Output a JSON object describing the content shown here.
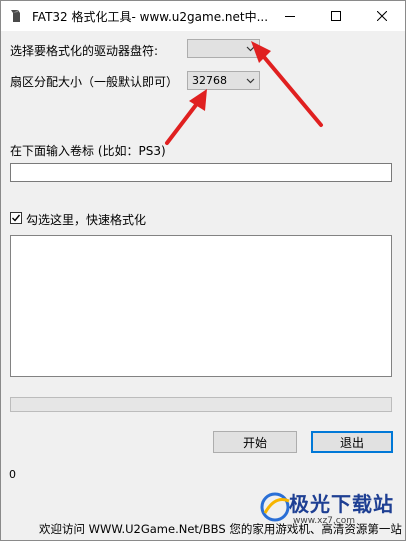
{
  "window": {
    "title": "FAT32 格式化工具- www.u2game.net中...",
    "controls": [
      "minimize-icon",
      "maximize-icon",
      "close-icon"
    ]
  },
  "drive": {
    "label": "选择要格式化的驱动器盘符:",
    "value": ""
  },
  "sector": {
    "label": "扇区分配大小（一般默认即可）",
    "value": "32768"
  },
  "volume": {
    "label": "在下面输入卷标 (比如：PS3)",
    "value": ""
  },
  "quick_format": {
    "label": "勾选这里，快速格式化",
    "checked": true
  },
  "progress": {
    "value": 0
  },
  "buttons": {
    "start": "开始",
    "exit": "退出"
  },
  "status": {
    "text": "0"
  },
  "footer": {
    "text": "欢迎访问 WWW.U2Game.Net/BBS 您的家用游戏机、高清资源第一站"
  },
  "watermark": {
    "text": "极光下载站",
    "url": "www.xz7.com"
  },
  "colors": {
    "arrow": "#e02020",
    "focus_border": "#0078d7",
    "watermark_blue": "#1e3f93"
  }
}
